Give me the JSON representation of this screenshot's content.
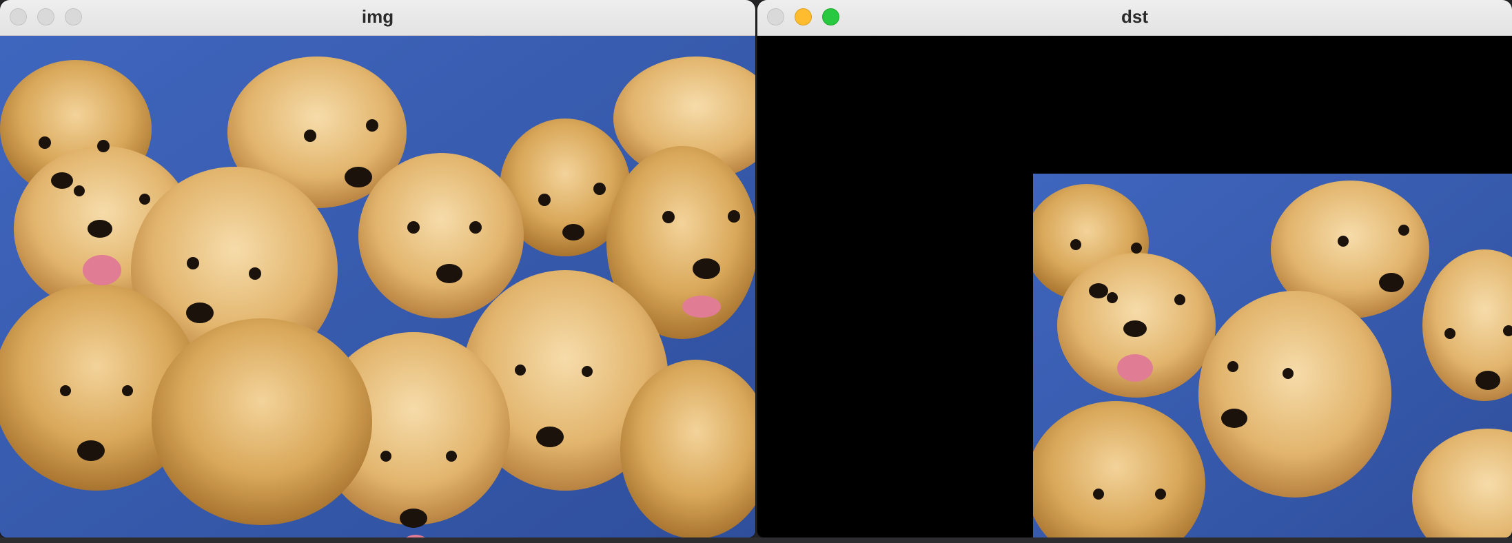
{
  "windows": [
    {
      "title": "img",
      "image_description_icon": "puppies-photo-icon",
      "traffic_lights": [
        "inactive",
        "inactive",
        "inactive"
      ]
    },
    {
      "title": "dst",
      "image_description_icon": "puppies-photo-shifted-icon",
      "traffic_lights": [
        "close",
        "minimize",
        "maximize"
      ]
    }
  ],
  "colors": {
    "background_black": "#000000",
    "cushion_blue": "#3a5fb3",
    "fur_golden": "#d9a85a"
  }
}
